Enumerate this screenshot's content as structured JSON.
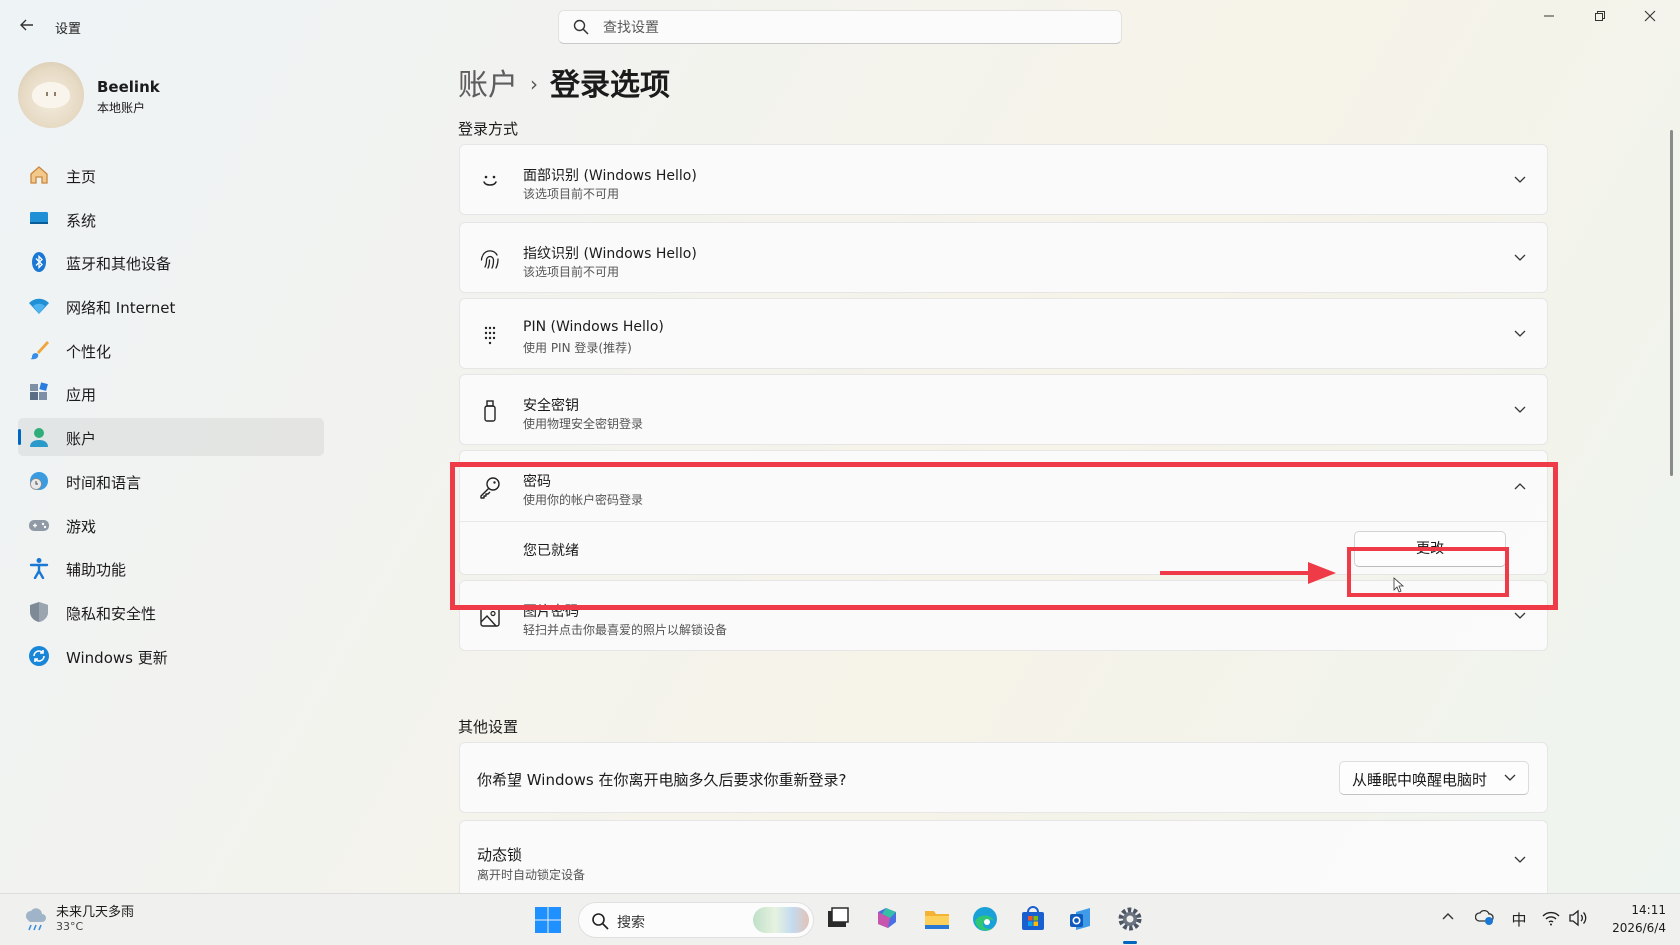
{
  "app": {
    "title": "设置"
  },
  "search": {
    "placeholder": "查找设置"
  },
  "profile": {
    "name": "Beelink",
    "account_type": "本地账户"
  },
  "sidebar": {
    "items": [
      {
        "label": "主页",
        "icon": "home-icon"
      },
      {
        "label": "系统",
        "icon": "system-icon"
      },
      {
        "label": "蓝牙和其他设备",
        "icon": "bluetooth-icon"
      },
      {
        "label": "网络和 Internet",
        "icon": "wifi-icon"
      },
      {
        "label": "个性化",
        "icon": "brush-icon"
      },
      {
        "label": "应用",
        "icon": "apps-icon"
      },
      {
        "label": "账户",
        "icon": "account-icon",
        "active": true
      },
      {
        "label": "时间和语言",
        "icon": "globe-clock-icon"
      },
      {
        "label": "游戏",
        "icon": "gamepad-icon"
      },
      {
        "label": "辅助功能",
        "icon": "accessibility-icon"
      },
      {
        "label": "隐私和安全性",
        "icon": "shield-icon"
      },
      {
        "label": "Windows 更新",
        "icon": "update-icon"
      }
    ]
  },
  "breadcrumb": {
    "parent": "账户",
    "separator": "›",
    "current": "登录选项"
  },
  "signin": {
    "section_label": "登录方式",
    "options": [
      {
        "title": "面部识别 (Windows Hello)",
        "subtitle": "该选项目前不可用",
        "icon": "face-icon"
      },
      {
        "title": "指纹识别 (Windows Hello)",
        "subtitle": "该选项目前不可用",
        "icon": "fingerprint-icon"
      },
      {
        "title": "PIN (Windows Hello)",
        "subtitle": "使用 PIN 登录(推荐)",
        "icon": "pin-keypad-icon"
      },
      {
        "title": "安全密钥",
        "subtitle": "使用物理安全密钥登录",
        "icon": "usb-key-icon"
      },
      {
        "title": "密码",
        "subtitle": "使用你的帐户密码登录",
        "icon": "key-icon",
        "expanded": true,
        "status": "您已就绪",
        "button_label": "更改"
      },
      {
        "title": "图片密码",
        "subtitle": "轻扫并点击你最喜爱的照片以解锁设备",
        "icon": "picture-icon"
      }
    ]
  },
  "other": {
    "section_label": "其他设置",
    "relogin_question": "你希望 Windows 在你离开电脑多久后要求你重新登录?",
    "relogin_value": "从睡眠中唤醒电脑时",
    "dynamic_lock": {
      "title": "动态锁",
      "subtitle": "离开时自动锁定设备"
    }
  },
  "taskbar": {
    "weather": {
      "text": "未来几天多雨",
      "temp": "33°C"
    },
    "search_label": "搜索",
    "ime": "中",
    "time": "14:11",
    "date": "2026/6/4"
  },
  "colors": {
    "accent": "#0067c0",
    "highlight": "#ee3b47"
  }
}
